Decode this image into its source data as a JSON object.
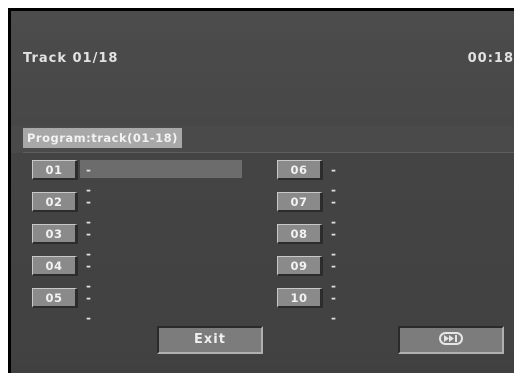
{
  "status": {
    "track_label": "Track  01/18",
    "time": "00:18"
  },
  "program": {
    "title": "Program:track(01-18)"
  },
  "slots": [
    {
      "num": "01",
      "value": "--"
    },
    {
      "num": "02",
      "value": "--"
    },
    {
      "num": "03",
      "value": "--"
    },
    {
      "num": "04",
      "value": "--"
    },
    {
      "num": "05",
      "value": "--"
    },
    {
      "num": "06",
      "value": "--"
    },
    {
      "num": "07",
      "value": "--"
    },
    {
      "num": "08",
      "value": "--"
    },
    {
      "num": "09",
      "value": "--"
    },
    {
      "num": "10",
      "value": "--"
    }
  ],
  "buttons": {
    "exit_label": "Exit",
    "next_icon": "next-track-icon"
  },
  "colors": {
    "screen_bg": "#4a4a4a",
    "slot_bg": "#8a8a8a",
    "highlight": "#6c6c6c"
  }
}
